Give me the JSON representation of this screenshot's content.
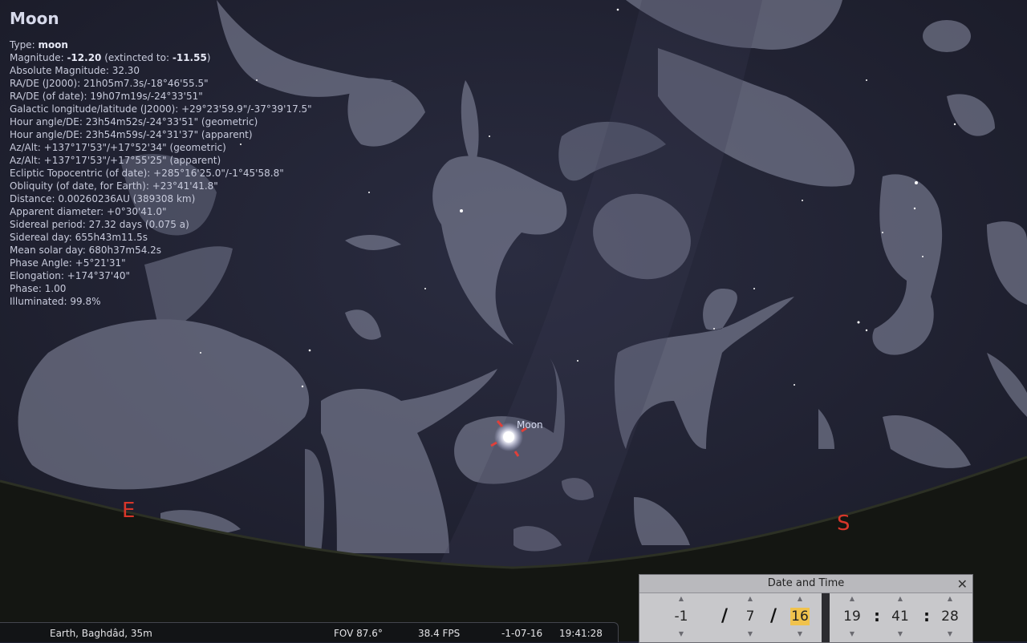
{
  "object": {
    "name": "Moon",
    "type_label": "Type:",
    "type_value": "moon",
    "magnitude_label": "Magnitude:",
    "magnitude_value": "-12.20",
    "extincted_label": "(extincted to:",
    "extincted_value": "-11.55",
    "extincted_close": ")",
    "lines": [
      "Absolute Magnitude: 32.30",
      "RA/DE (J2000): 21h05m7.3s/-18°46'55.5\"",
      "RA/DE (of date): 19h07m19s/-24°33'51\"",
      "Galactic longitude/latitude (J2000): +29°23'59.9\"/-37°39'17.5\"",
      "Hour angle/DE: 23h54m52s/-24°33'51\" (geometric)",
      "Hour angle/DE: 23h54m59s/-24°31'37\" (apparent)",
      "Az/Alt: +137°17'53\"/+17°52'34\" (geometric)",
      "Az/Alt: +137°17'53\"/+17°55'25\" (apparent)",
      "Ecliptic Topocentric (of date): +285°16'25.0\"/-1°45'58.8\"",
      "Obliquity (of date, for Earth): +23°41'41.8\"",
      "Distance: 0.00260236AU (389308 km)",
      "Apparent diameter: +0°30'41.0\"",
      "Sidereal period: 27.32 days (0.075 a)",
      "Sidereal day: 655h43m11.5s",
      "Mean solar day: 680h37m54.2s",
      "Phase Angle: +5°21'31\"",
      "Elongation: +174°37'40\"",
      "Phase: 1.00",
      "Illuminated: 99.8%"
    ]
  },
  "sky": {
    "moon_label": "Moon",
    "cardinal_east": "E",
    "cardinal_south": "S"
  },
  "status": {
    "location": "Earth, Baghdâd, 35m",
    "fov": "FOV 87.6°",
    "fps": "38.4 FPS",
    "date": "-1-07-16",
    "time": "19:41:28"
  },
  "datetime_dialog": {
    "title": "Date and Time",
    "year": "-1",
    "month": "7",
    "day": "16",
    "hour": "19",
    "minute": "41",
    "second": "28",
    "date_sep": "/",
    "time_sep": ":"
  },
  "colors": {
    "sky": "#1e2030",
    "ground": "#141612",
    "cardinal": "#d8362a",
    "target_marker": "#e0403a",
    "highlight": "#f0c24d"
  }
}
